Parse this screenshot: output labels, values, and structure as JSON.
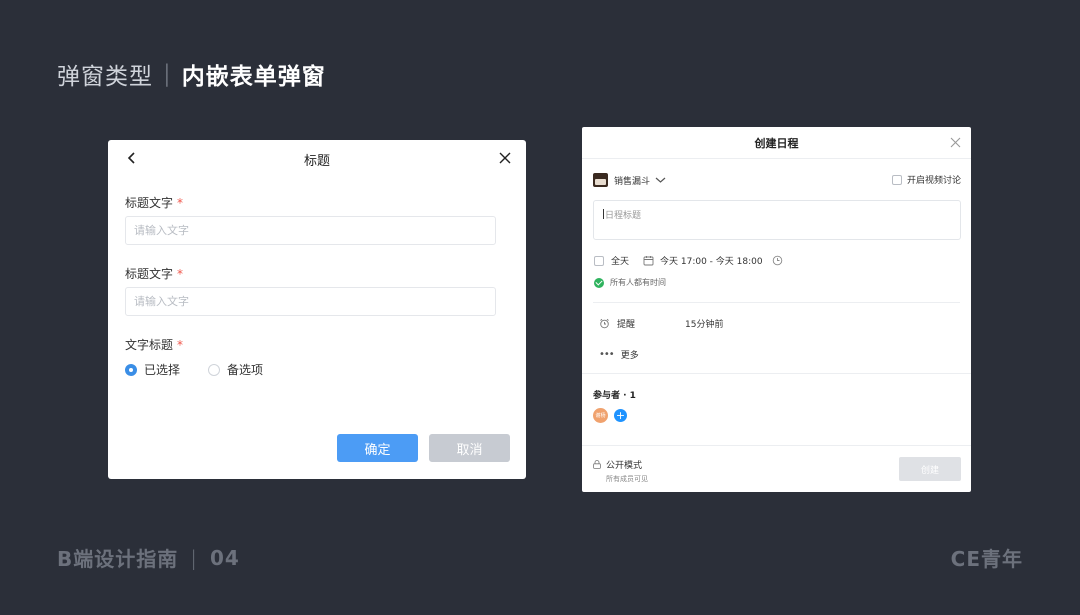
{
  "heading": {
    "prefix": "弹窗类型",
    "separator": "|",
    "emphasis": "内嵌表单弹窗"
  },
  "footer": {
    "left_text": "B端设计指南",
    "separator": "|",
    "number": "04",
    "right_text": "CE青年"
  },
  "dialog1": {
    "title": "标题",
    "fields": [
      {
        "label": "标题文字",
        "required_mark": "*",
        "placeholder": "请输入文字"
      },
      {
        "label": "标题文字",
        "required_mark": "*",
        "placeholder": "请输入文字"
      }
    ],
    "radio_group": {
      "label": "文字标题",
      "required_mark": "*",
      "options": [
        {
          "label": "已选择",
          "selected": true
        },
        {
          "label": "备选项",
          "selected": false
        }
      ]
    },
    "buttons": {
      "confirm": "确定",
      "cancel": "取消"
    },
    "colors": {
      "primary": "#4c9cf5",
      "secondary": "#c7cbd2",
      "required": "#f0564b"
    }
  },
  "dialog2": {
    "title": "创建日程",
    "calendar": "销售漏斗",
    "video_toggle": "开启视频讨论",
    "title_placeholder": "日程标题",
    "all_day": "全天",
    "time_range": "今天 17:00 - 今天 18:00",
    "availability": "所有人都有时间",
    "remind_label": "提醒",
    "remind_value": "15分钟前",
    "more": "更多",
    "participants": "参与者 · 1",
    "avatar_text": "谢杨",
    "public_mode": "公开模式",
    "public_sub": "所有成员可见",
    "create_button": "创建",
    "colors": {
      "add": "#1f93ff",
      "ok": "#2fb35e",
      "avatar": "#f0a26e"
    }
  }
}
